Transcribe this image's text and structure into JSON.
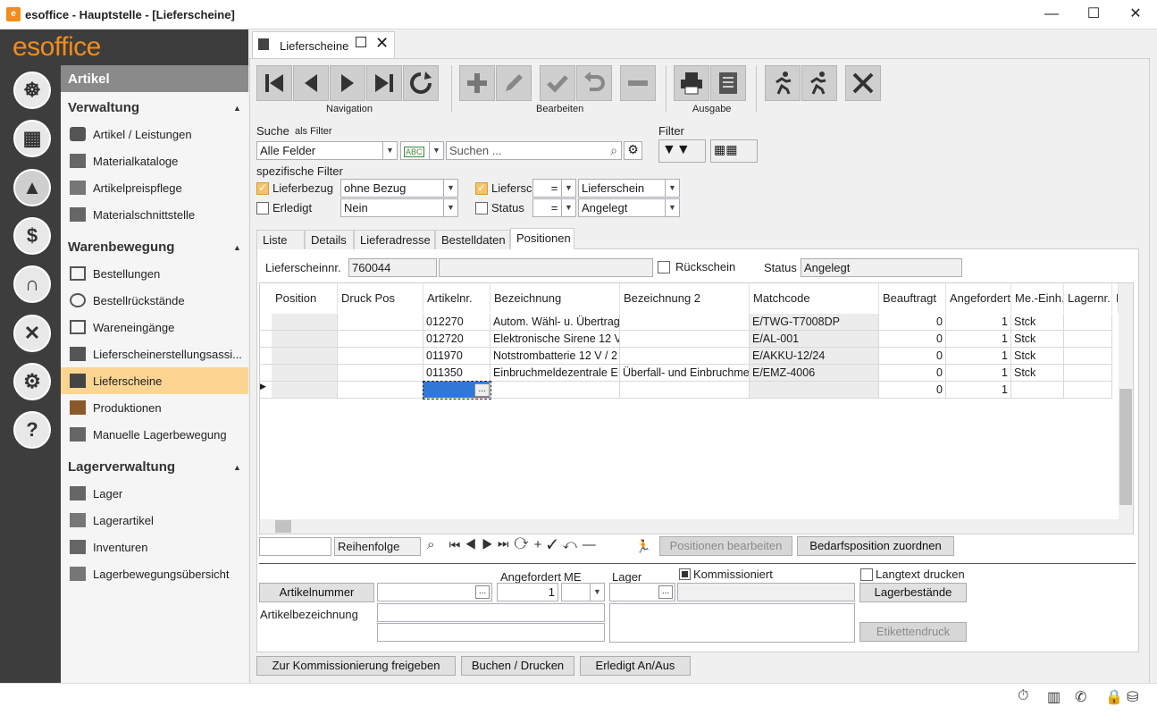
{
  "window": {
    "title": "esoffice - Hauptstelle - [Lieferscheine]",
    "minimize": "—",
    "maximize": "☐",
    "close": "✕"
  },
  "logo": "esoffice",
  "nav": {
    "header": "Artikel",
    "sections": [
      {
        "title": "Verwaltung",
        "items": [
          "Artikel / Leistungen",
          "Materialkataloge",
          "Artikelpreispflege",
          "Materialschnittstelle"
        ]
      },
      {
        "title": "Warenbewegung",
        "items": [
          "Bestellungen",
          "Bestellrückstände",
          "Wareneingänge",
          "Lieferscheinerstellungsassi...",
          "Lieferscheine",
          "Produktionen",
          "Manuelle Lagerbewegung"
        ]
      },
      {
        "title": "Lagerverwaltung",
        "items": [
          "Lager",
          "Lagerartikel",
          "Inventuren",
          "Lagerbewegungsübersicht"
        ]
      }
    ],
    "active": "Lieferscheine"
  },
  "tab": {
    "title": "Lieferscheine"
  },
  "toolbar": {
    "navigation": "Navigation",
    "bearbeiten": "Bearbeiten",
    "ausgabe": "Ausgabe"
  },
  "search": {
    "label": "Suche",
    "as_filter": "als Filter",
    "field": "Alle Felder",
    "placeholder": "Suchen ...",
    "filter_label": "Filter",
    "specific_filter": "spezifische Filter"
  },
  "filters": {
    "lieferbezug_label": "Lieferbezug",
    "lieferbezug_value": "ohne Bezug",
    "erledigt_label": "Erledigt",
    "erledigt_value": "Nein",
    "lieferscheintyp_label": "Liefersc",
    "lieferscheintyp_op": "=",
    "lieferscheintyp_value": "Lieferschein",
    "status_label": "Status",
    "status_op": "=",
    "status_value": "Angelegt"
  },
  "subtabs": [
    "Liste",
    "Details",
    "Lieferadresse",
    "Bestelldaten",
    "Positionen"
  ],
  "header_fields": {
    "lieferscheinnr_label": "Lieferscheinnr.",
    "lieferscheinnr": "760044",
    "rueckschein_label": "Rückschein",
    "status_label": "Status",
    "status": "Angelegt"
  },
  "grid": {
    "columns": [
      "Position",
      "Druck Pos",
      "Artikelnr.",
      "Bezeichnung",
      "Bezeichnung 2",
      "Matchcode",
      "Beauftragt",
      "Angefordert",
      "Me.-Einh.",
      "Lagernr.",
      "L"
    ],
    "rows": [
      [
        "",
        "",
        "012270",
        "Autom. Wähl- u. Übertrag",
        "",
        "E/TWG-T7008DP",
        "0",
        "1",
        "Stck",
        ""
      ],
      [
        "",
        "",
        "012720",
        "Elektronische Sirene 12 V",
        "",
        "E/AL-001",
        "0",
        "1",
        "Stck",
        ""
      ],
      [
        "",
        "",
        "011970",
        "Notstrombatterie 12 V / 2",
        "",
        "E/AKKU-12/24",
        "0",
        "1",
        "Stck",
        ""
      ],
      [
        "",
        "",
        "011350",
        "Einbruchmeldezentrale E",
        "Überfall- und Einbruchme",
        "E/EMZ-4006",
        "0",
        "1",
        "Stck",
        ""
      ],
      [
        "",
        "",
        "",
        "",
        "",
        "",
        "0",
        "1",
        "",
        ""
      ]
    ],
    "ellipsis": "..."
  },
  "gridbar": {
    "order": "Reihenfolge",
    "edit_positions": "Positionen bearbeiten",
    "assign_demand": "Bedarfsposition zuordnen"
  },
  "detail": {
    "artikelnummer_btn": "Artikelnummer",
    "angefordert_label": "Angefordert",
    "me_label": "ME",
    "angefordert_value": "1",
    "lager_label": "Lager",
    "kommissioniert_label": "Kommissioniert",
    "langtext_label": "Langtext drucken",
    "lagerbestaende_btn": "Lagerbestände",
    "artikelbezeichnung_label": "Artikelbezeichnung",
    "etikettendruck_btn": "Etikettendruck"
  },
  "actions": {
    "kommissionierung": "Zur Kommissionierung freigeben",
    "buchen": "Buchen / Drucken",
    "erledigt": "Erledigt An/Aus"
  }
}
